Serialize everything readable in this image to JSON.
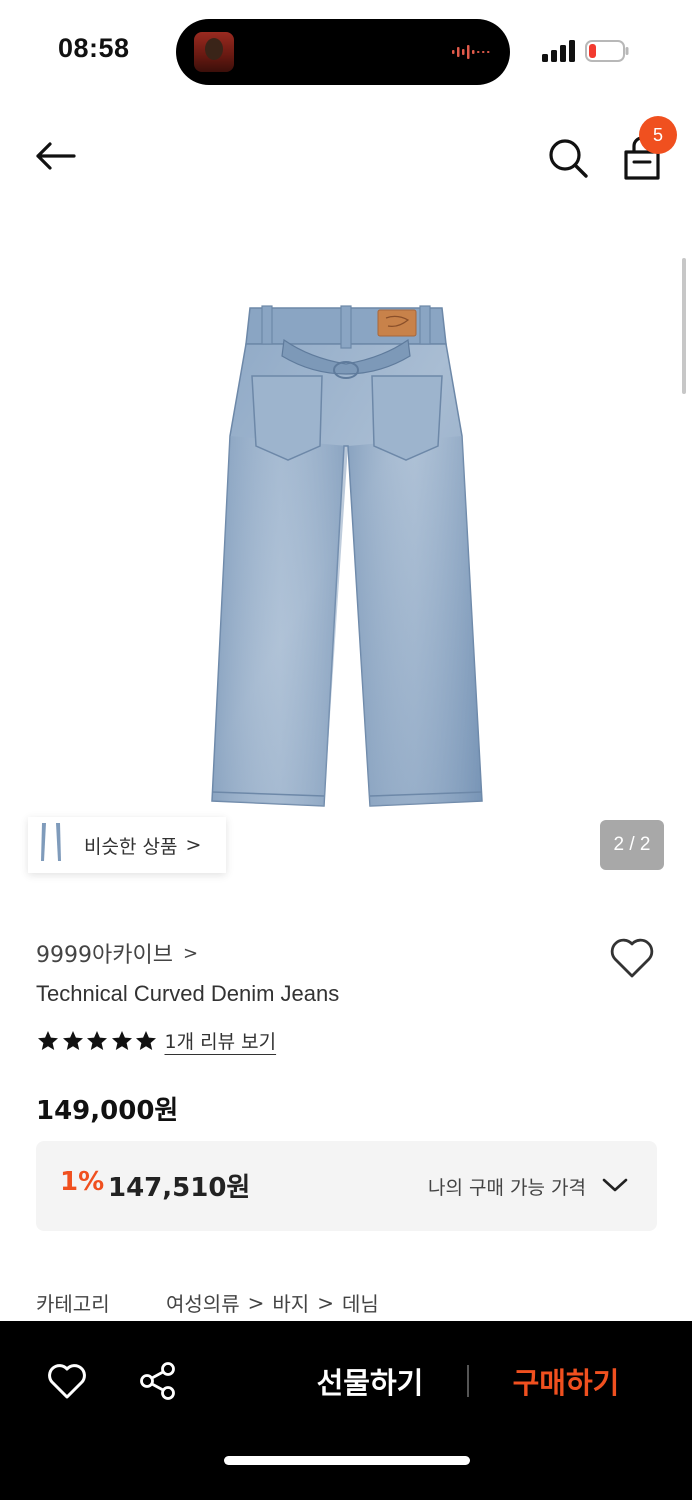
{
  "status_bar": {
    "time": "08:58"
  },
  "header": {
    "cart_count": "5"
  },
  "gallery": {
    "similar_label": "비슷한 상품",
    "similar_chevron": ">",
    "page_indicator": "2 / 2"
  },
  "product": {
    "brand": "9999아카이브",
    "brand_chevron": ">",
    "name": "Technical Curved Denim Jeans",
    "rating": 5,
    "rating_max": 5,
    "review_link": "1개 리뷰 보기",
    "price": "149,000원",
    "discount_rate": "1%",
    "discount_price": "147,510원",
    "my_price_label": "나의 구매 가능 가격"
  },
  "category": {
    "label": "카테고리",
    "path": [
      "여성의류",
      "바지",
      "데님"
    ],
    "separator": ">"
  },
  "bottom_bar": {
    "gift_label": "선물하기",
    "buy_label": "구매하기"
  },
  "colors": {
    "accent": "#f0501f",
    "bottom_bar": "#000000",
    "price_box": "#f4f4f4"
  },
  "icons": [
    "back-arrow-icon",
    "search-icon",
    "cart-icon",
    "heart-icon",
    "share-icon",
    "chevron-down-icon",
    "star-icon"
  ]
}
